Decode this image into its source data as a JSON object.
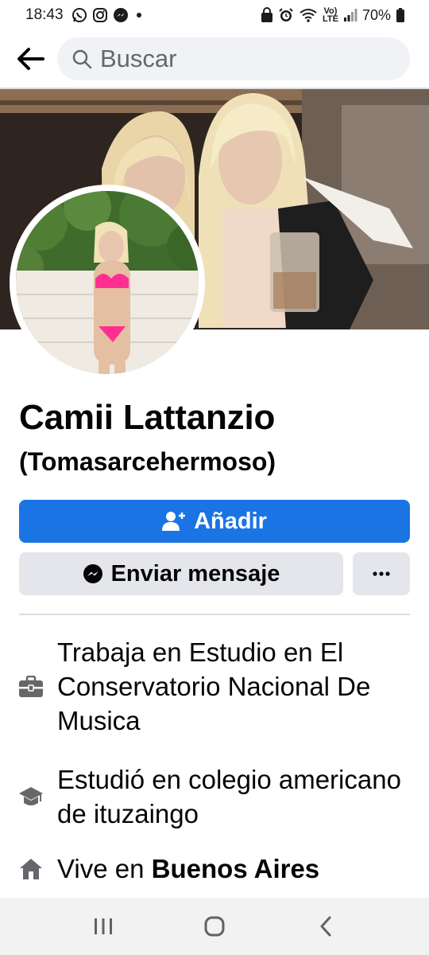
{
  "status_bar": {
    "time": "18:43",
    "volte_top": "Vo)",
    "volte_bottom": "LTE",
    "battery": "70%"
  },
  "search": {
    "placeholder": "Buscar"
  },
  "profile": {
    "name": "Camii Lattanzio",
    "alternate_name": "(Tomasarcehermoso)"
  },
  "actions": {
    "add_label": "Añadir",
    "message_label": "Enviar mensaje",
    "more_label": "···"
  },
  "intro": {
    "work": "Trabaja en Estudio en El Conservatorio Nacional De Musica",
    "education": "Estudió en colegio americano de ituzaingo",
    "lives_prefix": "Vive en ",
    "lives_city": "Buenos Aires"
  },
  "colors": {
    "primary_button": "#1b74e4",
    "secondary_button": "#e4e6eb",
    "search_background": "#f0f2f5",
    "nav_background": "#f2f2f2"
  },
  "icons": {
    "work": "briefcase-icon",
    "education": "graduation-cap-icon",
    "home": "home-icon",
    "add_friend": "add-friend-icon",
    "messenger": "messenger-icon"
  }
}
